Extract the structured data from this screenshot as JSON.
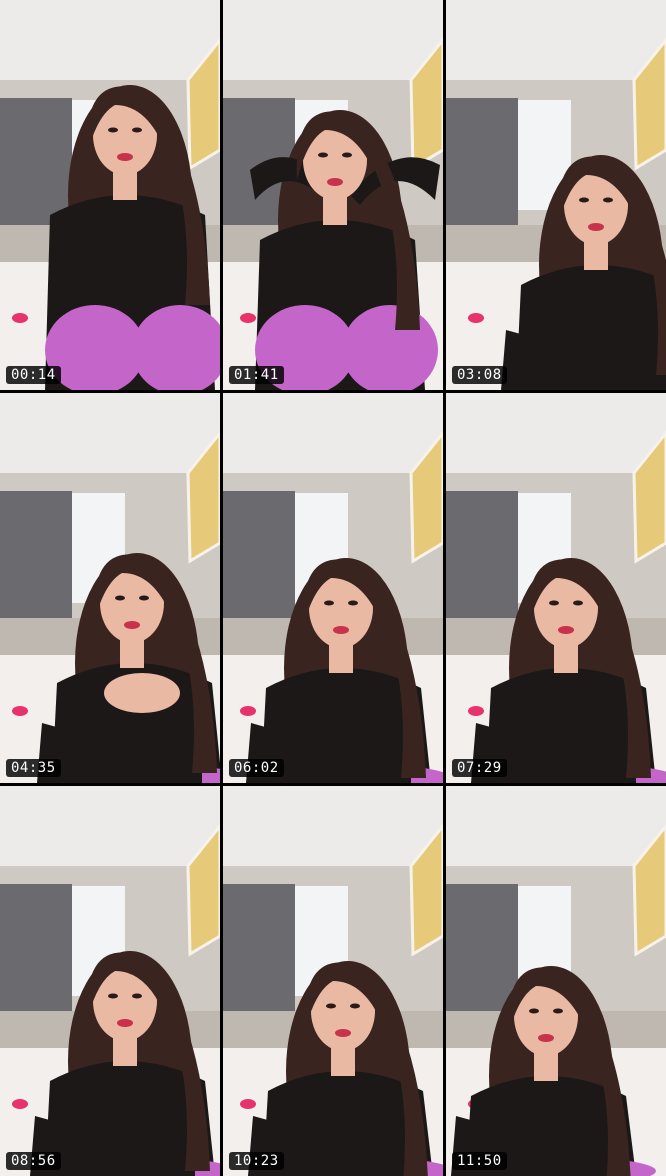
{
  "thumbnails": [
    {
      "timestamp": "00:14"
    },
    {
      "timestamp": "01:41"
    },
    {
      "timestamp": "03:08"
    },
    {
      "timestamp": "04:35"
    },
    {
      "timestamp": "06:02"
    },
    {
      "timestamp": "07:29"
    },
    {
      "timestamp": "08:56"
    },
    {
      "timestamp": "10:23"
    },
    {
      "timestamp": "11:50"
    }
  ],
  "colors": {
    "background": "#000000",
    "ceiling": "#ecebe9",
    "wall": "#cfc9c3",
    "curtain": "#6b6a6e",
    "window": "#f3f4f6",
    "bed": "#f2efec",
    "hair": "#3a2420",
    "shirt": "#1d1818",
    "skin": "#e9b9a4",
    "leggings": "#c466c9",
    "lips": "#c8324a",
    "timestamp_bg": "#000000",
    "timestamp_text": "#ffffff"
  }
}
